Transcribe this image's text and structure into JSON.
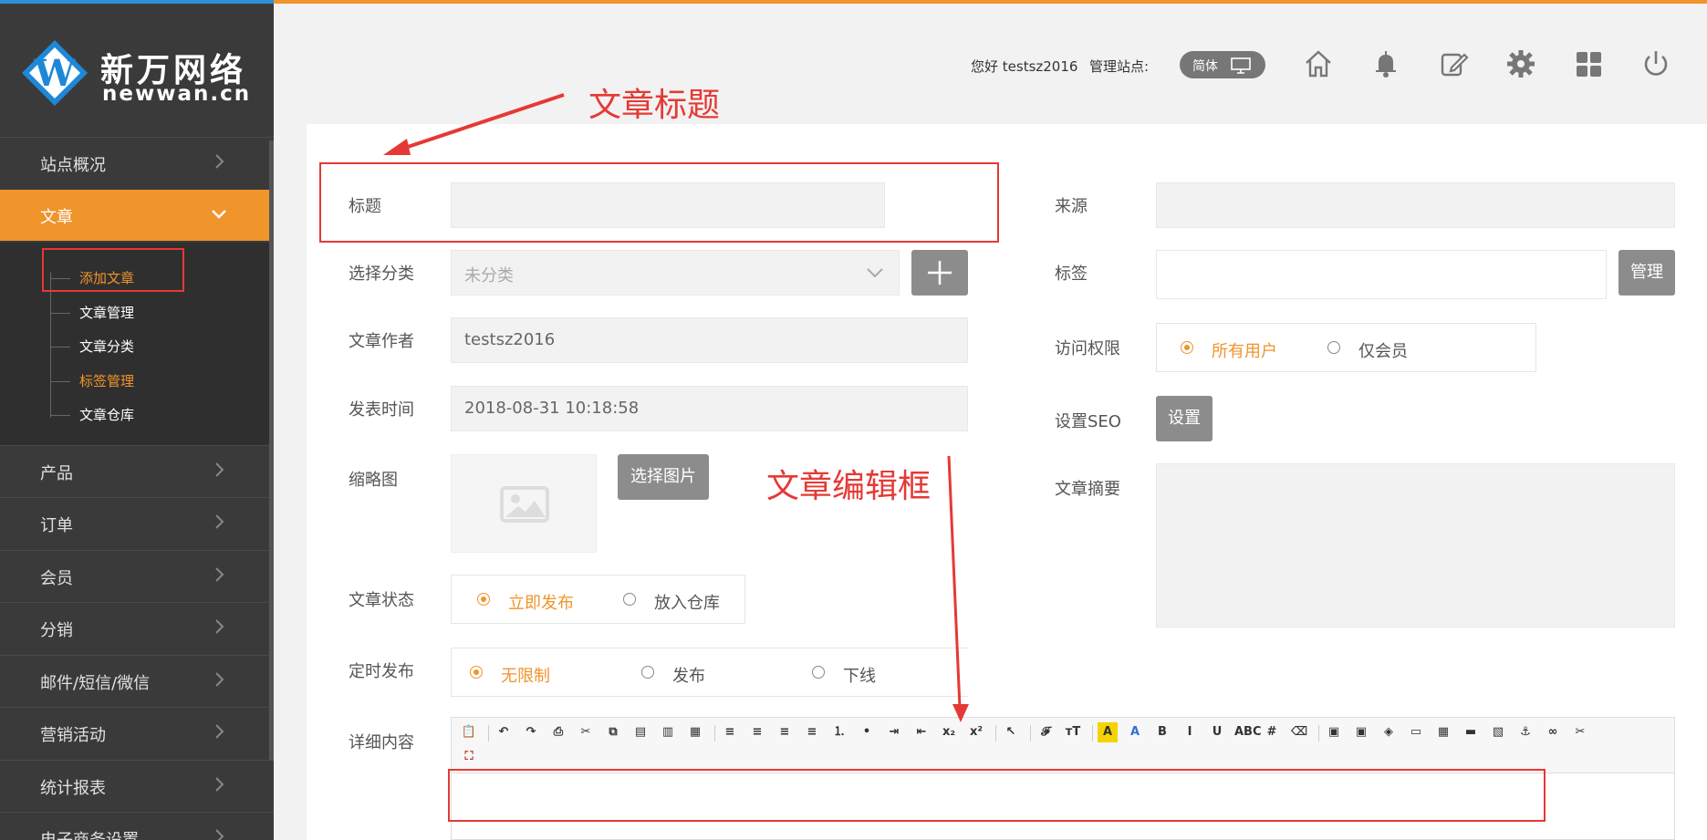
{
  "brand": {
    "name_cn": "新万网络",
    "name_en": "newwan.cn"
  },
  "sidebar": {
    "items": [
      {
        "label": "站点概况"
      },
      {
        "label": "文章"
      },
      {
        "label": "产品"
      },
      {
        "label": "订单"
      },
      {
        "label": "会员"
      },
      {
        "label": "分销"
      },
      {
        "label": "邮件/短信/微信"
      },
      {
        "label": "营销活动"
      },
      {
        "label": "统计报表"
      },
      {
        "label": "电子商务设置"
      }
    ],
    "submenu": [
      {
        "label": "添加文章"
      },
      {
        "label": "文章管理"
      },
      {
        "label": "文章分类"
      },
      {
        "label": "标签管理"
      },
      {
        "label": "文章仓库"
      }
    ]
  },
  "header": {
    "greeting": "您好 testsz2016",
    "site_label": "管理站点:",
    "lang": "简体",
    "icons": [
      "home-icon",
      "bell-icon",
      "edit-icon",
      "gear-icon",
      "grid-icon",
      "power-icon"
    ]
  },
  "form": {
    "title_label": "标题",
    "title_value": "",
    "category_label": "选择分类",
    "category_value": "未分类",
    "author_label": "文章作者",
    "author_value": "testsz2016",
    "time_label": "发表时间",
    "time_value": "2018-08-31 10:18:58",
    "thumb_label": "缩略图",
    "thumb_button": "选择图片",
    "status_label": "文章状态",
    "status_options": [
      "立即发布",
      "放入仓库"
    ],
    "schedule_label": "定时发布",
    "schedule_options": [
      "无限制",
      "发布",
      "下线"
    ],
    "content_label": "详细内容",
    "source_label": "来源",
    "tags_label": "标签",
    "tags_button": "管理",
    "access_label": "访问权限",
    "access_options": [
      "所有用户",
      "仅会员"
    ],
    "seo_label": "设置SEO",
    "seo_button": "设置",
    "summary_label": "文章摘要"
  },
  "annotations": {
    "title_note": "文章标题",
    "editor_note": "文章编辑框"
  },
  "colors": {
    "accent": "#f0942c",
    "sidebar": "#3a3a3a",
    "annotation": "#e53935"
  }
}
